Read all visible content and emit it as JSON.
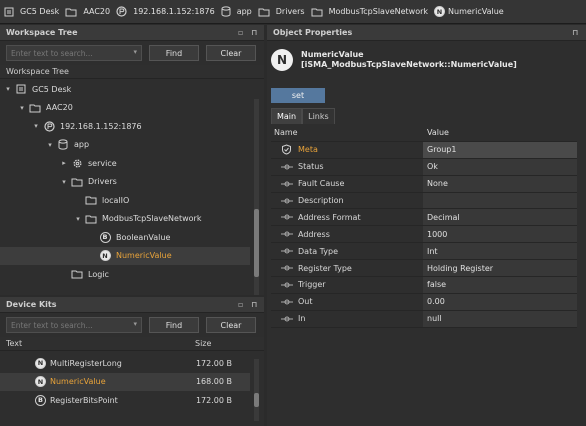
{
  "breadcrumb": [
    {
      "icon": "station-icon",
      "label": "GC5 Desk"
    },
    {
      "icon": "folder-icon",
      "label": "AAC20"
    },
    {
      "icon": "device-icon",
      "label": "192.168.1.152:1876"
    },
    {
      "icon": "database-icon",
      "label": "app"
    },
    {
      "icon": "folder-icon",
      "label": "Drivers"
    },
    {
      "icon": "folder-icon",
      "label": "ModbusTcpSlaveNetwork"
    },
    {
      "icon": "n-badge-icon",
      "label": "NumericValue"
    }
  ],
  "workspace": {
    "title": "Workspace Tree",
    "search_placeholder": "Enter text to search...",
    "find": "Find",
    "clear": "Clear",
    "subheader": "Workspace Tree",
    "nodes": [
      {
        "depth": 0,
        "arrow": "▾",
        "icon": "station-icon",
        "label": "GC5 Desk"
      },
      {
        "depth": 1,
        "arrow": "▾",
        "icon": "folder-icon",
        "label": "AAC20"
      },
      {
        "depth": 2,
        "arrow": "▾",
        "icon": "device-icon",
        "label": "192.168.1.152:1876"
      },
      {
        "depth": 3,
        "arrow": "▾",
        "icon": "database-icon",
        "label": "app"
      },
      {
        "depth": 4,
        "arrow": "▸",
        "icon": "gear-icon",
        "label": "service"
      },
      {
        "depth": 4,
        "arrow": "▾",
        "icon": "folder-icon",
        "label": "Drivers"
      },
      {
        "depth": 5,
        "arrow": "",
        "icon": "folder-icon",
        "label": "localIO"
      },
      {
        "depth": 5,
        "arrow": "▾",
        "icon": "folder-icon",
        "label": "ModbusTcpSlaveNetwork"
      },
      {
        "depth": 6,
        "arrow": "",
        "icon": "b-badge-icon",
        "label": "BooleanValue"
      },
      {
        "depth": 6,
        "arrow": "",
        "icon": "n-badge-icon",
        "label": "NumericValue",
        "selected": true
      },
      {
        "depth": 4,
        "arrow": "",
        "icon": "folder-icon",
        "label": "Logic"
      }
    ]
  },
  "devicekits": {
    "title": "Device Kits",
    "search_placeholder": "Enter text to search...",
    "find": "Find",
    "clear": "Clear",
    "col_text": "Text",
    "col_size": "Size",
    "items": [
      {
        "icon": "n-badge-icon",
        "label": "MultiRegisterLong",
        "size": "172.00 B"
      },
      {
        "icon": "n-badge-icon",
        "label": "NumericValue",
        "size": "168.00 B",
        "selected": true
      },
      {
        "icon": "b-badge-icon",
        "label": "RegisterBitsPoint",
        "size": "172.00 B"
      }
    ]
  },
  "props": {
    "title": "Object Properties",
    "obj_name": "NumericValue",
    "obj_type": "[iSMA_ModbusTcpSlaveNetwork::NumericValue]",
    "set": "set",
    "tabs": [
      "Main",
      "Links"
    ],
    "col_name": "Name",
    "col_value": "Value",
    "rows": [
      {
        "name": "Meta",
        "value": "Group1",
        "icon": "shield-icon",
        "meta": true
      },
      {
        "name": "Status",
        "value": "Ok"
      },
      {
        "name": "Fault Cause",
        "value": "None"
      },
      {
        "name": "Description",
        "value": ""
      },
      {
        "name": "Address Format",
        "value": "Decimal"
      },
      {
        "name": "Address",
        "value": "1000"
      },
      {
        "name": "Data Type",
        "value": "Int"
      },
      {
        "name": "Register Type",
        "value": "Holding Register"
      },
      {
        "name": "Trigger",
        "value": "false"
      },
      {
        "name": "Out",
        "value": "0.00"
      },
      {
        "name": "In",
        "value": "null"
      }
    ]
  },
  "colors": {
    "accent": "#e8a33a",
    "set_button": "#55789e"
  }
}
